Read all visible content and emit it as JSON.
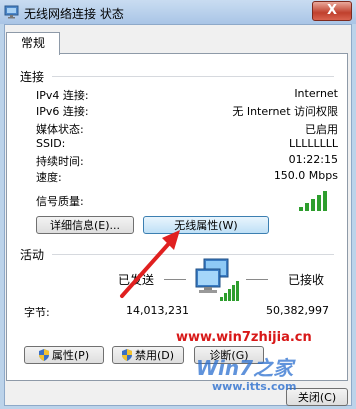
{
  "window": {
    "title": "无线网络连接 状态",
    "close_glyph": "X"
  },
  "tab": {
    "label": "常规"
  },
  "connection": {
    "group_label": "连接",
    "rows": [
      {
        "label": "IPv4 连接:",
        "value": "Internet"
      },
      {
        "label": "IPv6 连接:",
        "value": "无 Internet 访问权限"
      },
      {
        "label": "媒体状态:",
        "value": "已启用"
      },
      {
        "label": "SSID:",
        "value": "LLLLLLLL"
      },
      {
        "label": "持续时间:",
        "value": "01:22:15"
      },
      {
        "label": "速度:",
        "value": "150.0 Mbps"
      }
    ],
    "signal_label": "信号质量:",
    "signal_bars_lit": 5,
    "signal_bars_total": 5,
    "details_button": "详细信息(E)...",
    "wireless_props_button": "无线属性(W)"
  },
  "activity": {
    "group_label": "活动",
    "sent_label": "已发送",
    "received_label": "已接收",
    "bytes_label": "字节:",
    "bytes_sent": "14,013,231",
    "bytes_received": "50,382,997"
  },
  "buttons": {
    "properties": "属性(P)",
    "disable": "禁用(D)",
    "diagnose": "诊断(G)",
    "close": "关闭(C)"
  },
  "watermark": {
    "url_top": "www.win7zhijia.cn",
    "brand": "Win7之家",
    "url_bottom": "www.itts.com"
  },
  "colors": {
    "arrow": "#e02020",
    "signal_green": "#2e9e2e",
    "watermark_red": "#d81818"
  }
}
